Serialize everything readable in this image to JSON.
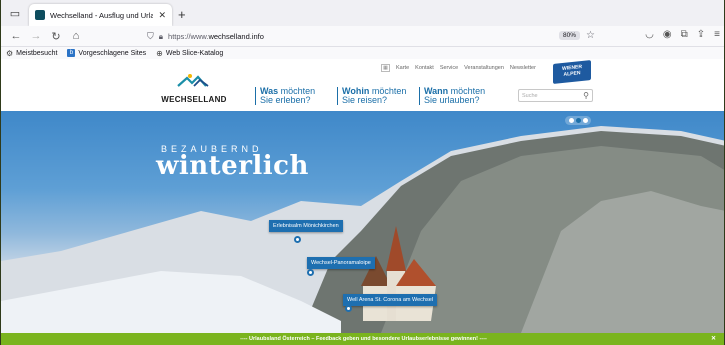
{
  "browser": {
    "tab": {
      "title": "Wechselland - Ausflug und Urla",
      "close": "✕"
    },
    "new_tab": "+",
    "url": {
      "prefix": "https://www.",
      "host": "wechselland.info"
    },
    "zoom": "80%",
    "bookmarks": [
      "Meistbesucht",
      "Vorgeschlagene Sites",
      "Web Slice-Katalog"
    ]
  },
  "site": {
    "logo_text": "WECHSELLAND",
    "top_nav": [
      "Karte",
      "Kontakt",
      "Service",
      "Veranstaltungen",
      "Newsletter"
    ],
    "badge": {
      "line1": "WIENER",
      "line2": "ALPEN"
    },
    "questions": [
      {
        "bold": "Was",
        "rest": " möchten",
        "line2": "Sie erleben?"
      },
      {
        "bold": "Wohin",
        "rest": " möchten",
        "line2": "Sie reisen?"
      },
      {
        "bold": "Wann",
        "rest": " möchten",
        "line2": "Sie urlauben?"
      }
    ],
    "search_placeholder": "Suche"
  },
  "hero": {
    "kicker": "BEZAUBERND",
    "headline": "winterlich",
    "pins": [
      "Erlebnisalm Mönichkirchen",
      "Wechsel-Panoramaloipe",
      "Well Arena St. Corona am Wechsel"
    ]
  },
  "banner": {
    "text": "---- Urlaubsland Österreich – Feedback geben und besondere Urlaubserlebnisse gewinnen! ----",
    "close": "✕"
  },
  "colors": {
    "accent": "#1b6fa8",
    "banner": "#7ab41e",
    "frame": "#4f5f2c"
  }
}
